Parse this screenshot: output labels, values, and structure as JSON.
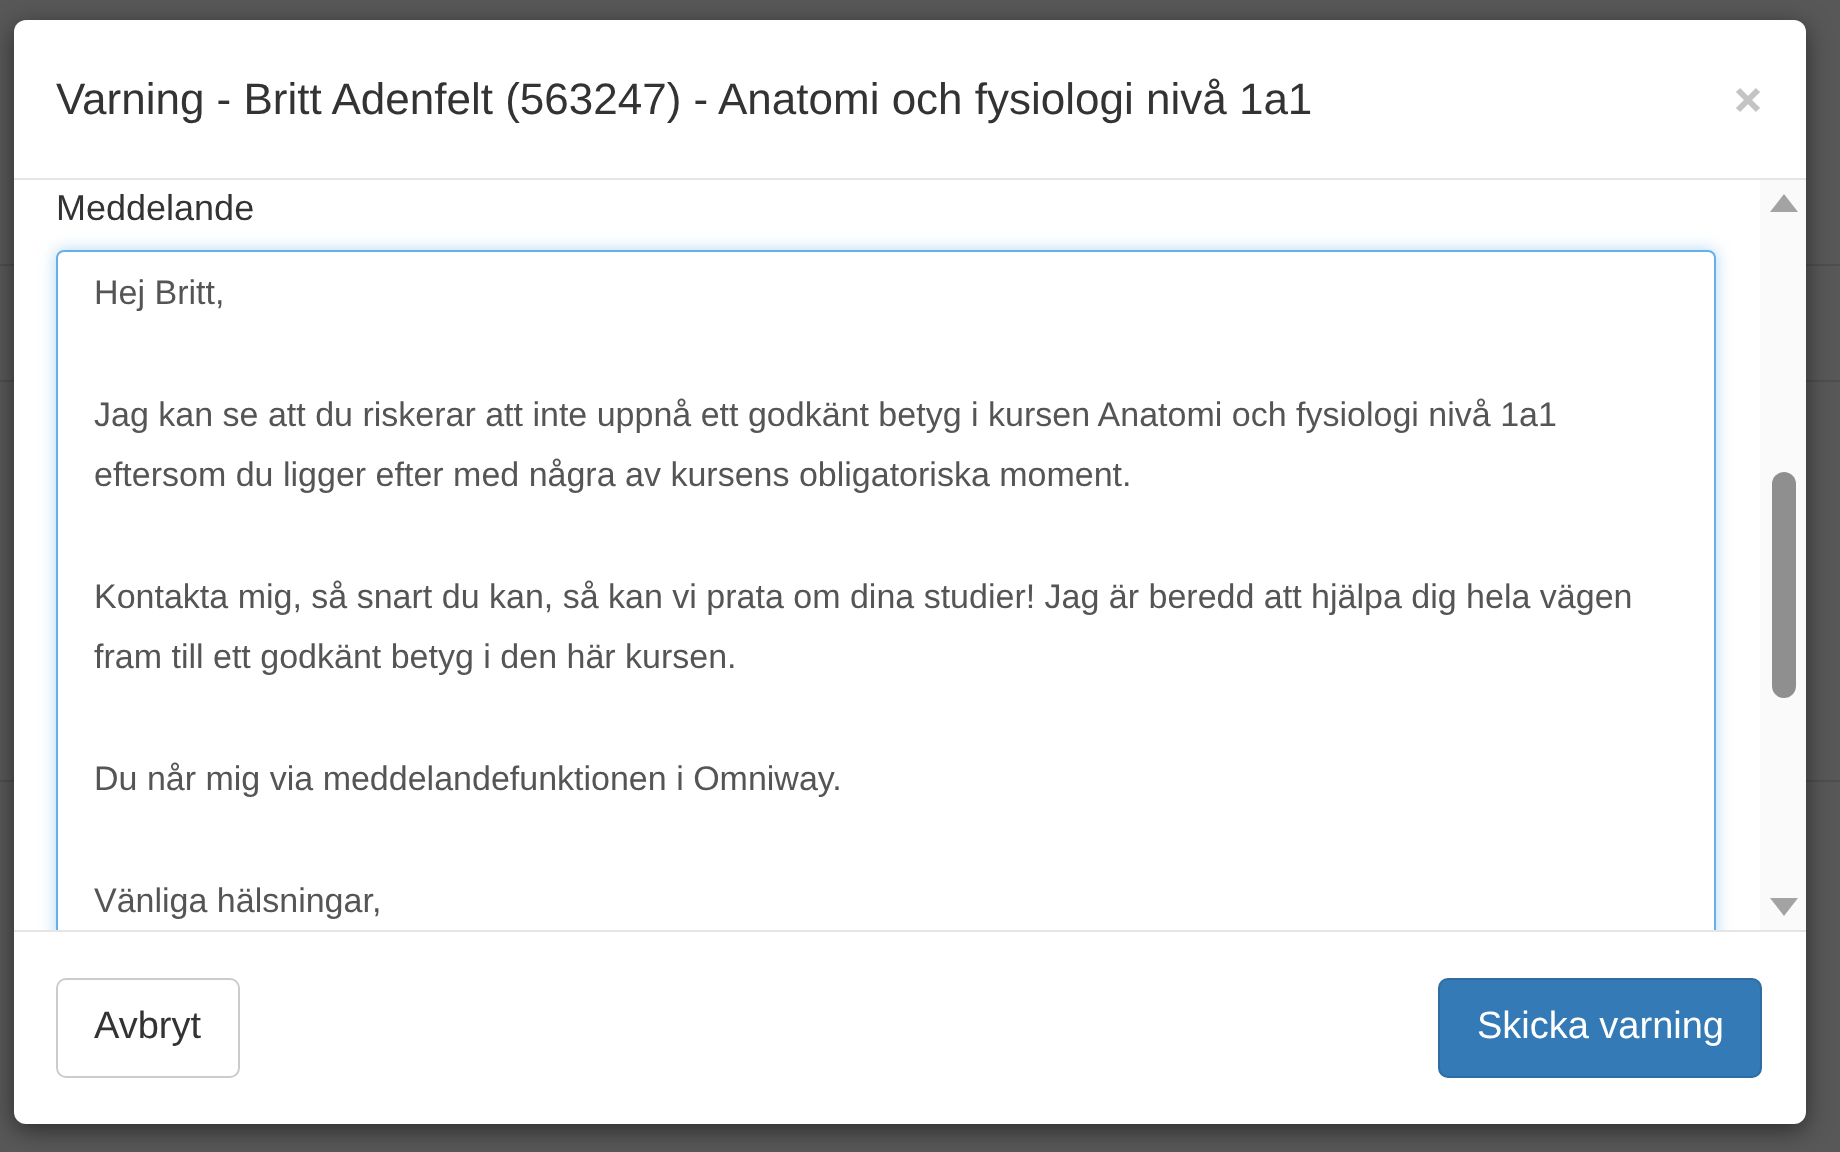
{
  "dialog": {
    "title": "Varning - Britt Adenfelt (563247)  - Anatomi och fysiologi nivå 1a1",
    "message": {
      "label": "Meddelande",
      "paragraphs": [
        "Hej Britt,",
        "Jag kan se att du riskerar att inte uppnå ett godkänt betyg i kursen Anatomi och fysiologi nivå 1a1 eftersom du ligger efter med några av kursens obligatoriska moment.",
        "Kontakta mig, så snart du kan, så kan vi prata om dina studier! Jag är beredd att hjälpa dig hela vägen fram till ett godkänt betyg i den här kursen.",
        "Du når mig via meddelandefunktionen i Omniway.",
        "Vänliga hälsningar,"
      ]
    },
    "buttons": [
      {
        "label": "Avbryt",
        "kind": "secondary"
      },
      {
        "label": "Skicka varning",
        "kind": "primary"
      }
    ]
  }
}
